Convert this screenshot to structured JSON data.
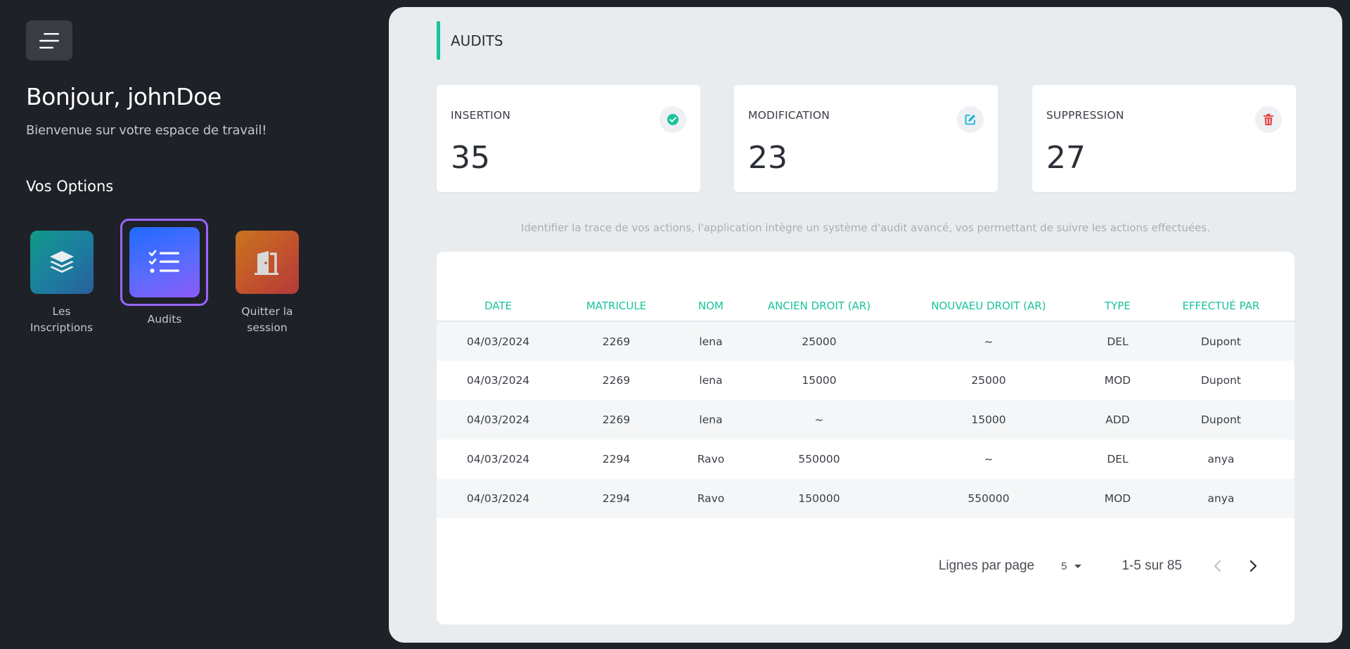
{
  "sidebar": {
    "greeting": "Bonjour, johnDoe",
    "welcome": "Bienvenue sur votre espace de travail!",
    "options_title": "Vos Options",
    "options": [
      {
        "label_line1": "Les",
        "label_line2": "Inscriptions",
        "icon": "layers-icon",
        "color": "#1d7aa0"
      },
      {
        "label_line1": "Audits",
        "label_line2": "",
        "icon": "checklist-icon",
        "color": "#3d6bff",
        "active": true
      },
      {
        "label_line1": "Quitter la",
        "label_line2": "session",
        "icon": "door-icon",
        "color": "#c2522c"
      }
    ]
  },
  "main": {
    "title": "AUDITS",
    "accent_color": "#19c39b",
    "stats": [
      {
        "label": "INSERTION",
        "value": "35",
        "icon": "check-circle-icon",
        "color": "#19c39b"
      },
      {
        "label": "MODIFICATION",
        "value": "23",
        "icon": "edit-icon",
        "color": "#19b6d6"
      },
      {
        "label": "SUPPRESSION",
        "value": "27",
        "icon": "trash-icon",
        "color": "#e5484d"
      }
    ],
    "info": "Identifier la trace de vos actions, l'application intègre un système d'audit avancé, vos permettant de suivre les actions effectuées.",
    "table": {
      "headers": [
        "DATE",
        "MATRICULE",
        "NOM",
        "ANCIEN DROIT (AR)",
        "NOUVAEU DROIT (AR)",
        "TYPE",
        "EFFECTUÉ PAR"
      ],
      "rows": [
        [
          "04/03/2024",
          "2269",
          "lena",
          "25000",
          "~",
          "DEL",
          "Dupont"
        ],
        [
          "04/03/2024",
          "2269",
          "lena",
          "15000",
          "25000",
          "MOD",
          "Dupont"
        ],
        [
          "04/03/2024",
          "2269",
          "lena",
          "~",
          "15000",
          "ADD",
          "Dupont"
        ],
        [
          "04/03/2024",
          "2294",
          "Ravo",
          "550000",
          "~",
          "DEL",
          "anya"
        ],
        [
          "04/03/2024",
          "2294",
          "Ravo",
          "150000",
          "550000",
          "MOD",
          "anya"
        ]
      ]
    },
    "pagination": {
      "rows_label": "Lignes par page",
      "rows_per_page": "5",
      "range": "1-5 sur 85"
    }
  }
}
